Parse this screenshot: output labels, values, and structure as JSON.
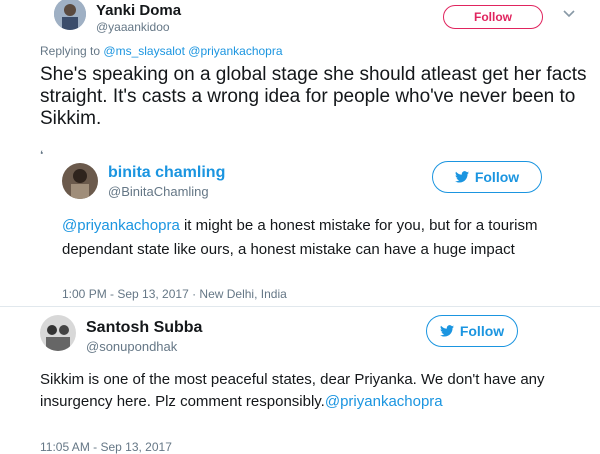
{
  "tweet1": {
    "name": "Yanki Doma",
    "handle": "@yaaankidoo",
    "follow_label": "Follow",
    "replying_prefix": "Replying to",
    "replying_to_1": "@ms_slaysalot",
    "replying_to_2": "@priyankachopra",
    "text": "She's speaking on a global stage she should atleast get her facts straight. It's casts a wrong idea for people who've never been to Sikkim."
  },
  "tweet2": {
    "name": "binita chamling",
    "handle": "@BinitaChamling",
    "follow_label": "Follow",
    "mention": "@priyankachopra",
    "text": " it might be a honest mistake for you, but for a tourism dependant state like ours, a honest mistake can have a huge impact",
    "timestamp": "1:00 PM - Sep 13, 2017 · New Delhi, India"
  },
  "tweet3": {
    "name": "Santosh Subba",
    "handle": "@sonupondhak",
    "follow_label": "Follow",
    "text": "Sikkim is one of the most peaceful states, dear Priyanka. We don't have any insurgency here. Plz comment responsibly.",
    "mention": "@priyankachopra",
    "timestamp": "11:05 AM - Sep 13, 2017"
  },
  "colors": {
    "accent": "#1b95e0",
    "follow_red": "#e0245e",
    "muted": "#657786"
  }
}
